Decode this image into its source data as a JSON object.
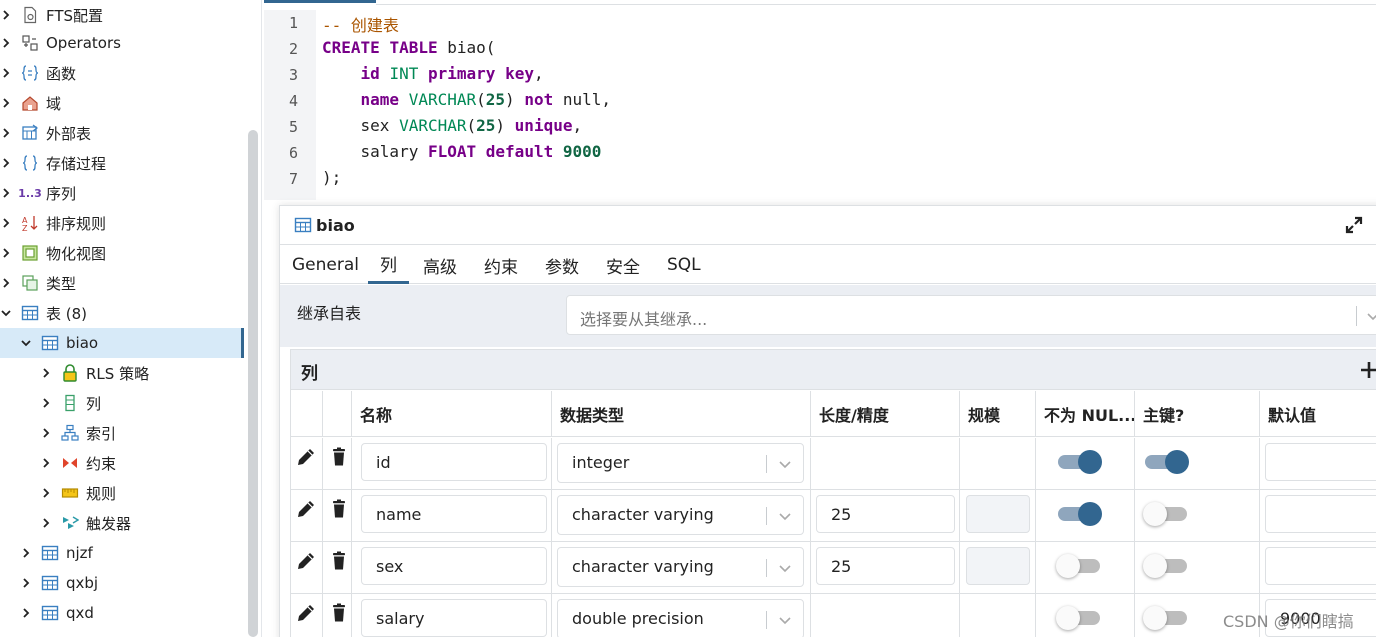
{
  "tree": {
    "items": [
      {
        "label": "FTS配置",
        "icon": "fts-config-icon",
        "expanded": false
      },
      {
        "label": "Operators",
        "icon": "operators-icon",
        "expanded": false
      },
      {
        "label": "函数",
        "icon": "function-icon",
        "expanded": false
      },
      {
        "label": "域",
        "icon": "domain-icon",
        "expanded": false
      },
      {
        "label": "外部表",
        "icon": "foreign-table-icon",
        "expanded": false
      },
      {
        "label": "存储过程",
        "icon": "procedure-icon",
        "expanded": false
      },
      {
        "label": "序列",
        "icon": "sequence-icon",
        "expanded": false,
        "icon_text": "1..3"
      },
      {
        "label": "排序规则",
        "icon": "collation-icon",
        "expanded": false
      },
      {
        "label": "物化视图",
        "icon": "materialized-view-icon",
        "expanded": false
      },
      {
        "label": "类型",
        "icon": "type-icon",
        "expanded": false
      },
      {
        "label": "表 (8)",
        "icon": "table-icon",
        "expanded": true
      },
      {
        "label": "biao",
        "icon": "table-icon",
        "expanded": true,
        "selected": true
      },
      {
        "label": "RLS 策略",
        "icon": "lock-icon",
        "expanded": false
      },
      {
        "label": "列",
        "icon": "columns-icon",
        "expanded": false
      },
      {
        "label": "索引",
        "icon": "index-icon",
        "expanded": false
      },
      {
        "label": "约束",
        "icon": "constraint-icon",
        "expanded": false
      },
      {
        "label": "规则",
        "icon": "rule-icon",
        "expanded": false
      },
      {
        "label": "触发器",
        "icon": "trigger-icon",
        "expanded": false
      },
      {
        "label": "njzf",
        "icon": "table-icon",
        "expanded": false
      },
      {
        "label": "qxbj",
        "icon": "table-icon",
        "expanded": false
      },
      {
        "label": "qxd",
        "icon": "table-icon",
        "expanded": false
      }
    ]
  },
  "editor": {
    "line_numbers": [
      "1",
      "2",
      "3",
      "4",
      "5",
      "6",
      "7"
    ],
    "lines": [
      [
        {
          "t": "-- 创建表",
          "c": "cm"
        }
      ],
      [
        {
          "t": "CREATE",
          "c": "kw"
        },
        {
          "t": " ",
          "c": ""
        },
        {
          "t": "TABLE",
          "c": "kw"
        },
        {
          "t": " biao(",
          "c": ""
        }
      ],
      [
        {
          "t": "    ",
          "c": ""
        },
        {
          "t": "id",
          "c": "kw"
        },
        {
          "t": " ",
          "c": ""
        },
        {
          "t": "INT",
          "c": "ty"
        },
        {
          "t": " ",
          "c": ""
        },
        {
          "t": "primary",
          "c": "kw"
        },
        {
          "t": " ",
          "c": ""
        },
        {
          "t": "key",
          "c": "kw"
        },
        {
          "t": ",",
          "c": ""
        }
      ],
      [
        {
          "t": "    ",
          "c": ""
        },
        {
          "t": "name",
          "c": "kw"
        },
        {
          "t": " ",
          "c": ""
        },
        {
          "t": "VARCHAR",
          "c": "ty"
        },
        {
          "t": "(",
          "c": ""
        },
        {
          "t": "25",
          "c": "num"
        },
        {
          "t": ") ",
          "c": ""
        },
        {
          "t": "not",
          "c": "kw"
        },
        {
          "t": " null,",
          "c": ""
        }
      ],
      [
        {
          "t": "    sex ",
          "c": ""
        },
        {
          "t": "VARCHAR",
          "c": "ty"
        },
        {
          "t": "(",
          "c": ""
        },
        {
          "t": "25",
          "c": "num"
        },
        {
          "t": ") ",
          "c": ""
        },
        {
          "t": "unique",
          "c": "kw"
        },
        {
          "t": ",",
          "c": ""
        }
      ],
      [
        {
          "t": "    salary ",
          "c": ""
        },
        {
          "t": "FLOAT",
          "c": "kw"
        },
        {
          "t": " ",
          "c": ""
        },
        {
          "t": "default",
          "c": "kw"
        },
        {
          "t": " ",
          "c": ""
        },
        {
          "t": "9000",
          "c": "num"
        }
      ],
      [
        {
          "t": ");",
          "c": ""
        }
      ]
    ]
  },
  "dialog": {
    "title": "biao",
    "tabs": [
      "General",
      "列",
      "高级",
      "约束",
      "参数",
      "安全",
      "SQL"
    ],
    "active_tab": "列",
    "inherit_label": "继承自表",
    "inherit_placeholder": "选择要从其继承...",
    "columns_title": "列",
    "headers": [
      "名称",
      "数据类型",
      "长度/精度",
      "规模",
      "不为 NUL...",
      "主键?",
      "默认值"
    ],
    "rows": [
      {
        "name": "id",
        "type": "integer",
        "length": "",
        "not_null": true,
        "primary_key": true,
        "default": ""
      },
      {
        "name": "name",
        "type": "character varying",
        "length": "25",
        "not_null": true,
        "primary_key": false,
        "default": ""
      },
      {
        "name": "sex",
        "type": "character varying",
        "length": "25",
        "not_null": false,
        "primary_key": false,
        "default": ""
      },
      {
        "name": "salary",
        "type": "double precision",
        "length": "",
        "not_null": false,
        "primary_key": false,
        "default": "9000"
      }
    ]
  },
  "watermark": "CSDN @你们瞎搞",
  "colors": {
    "accent": "#326690",
    "selected_bg": "#d7eaf8"
  }
}
